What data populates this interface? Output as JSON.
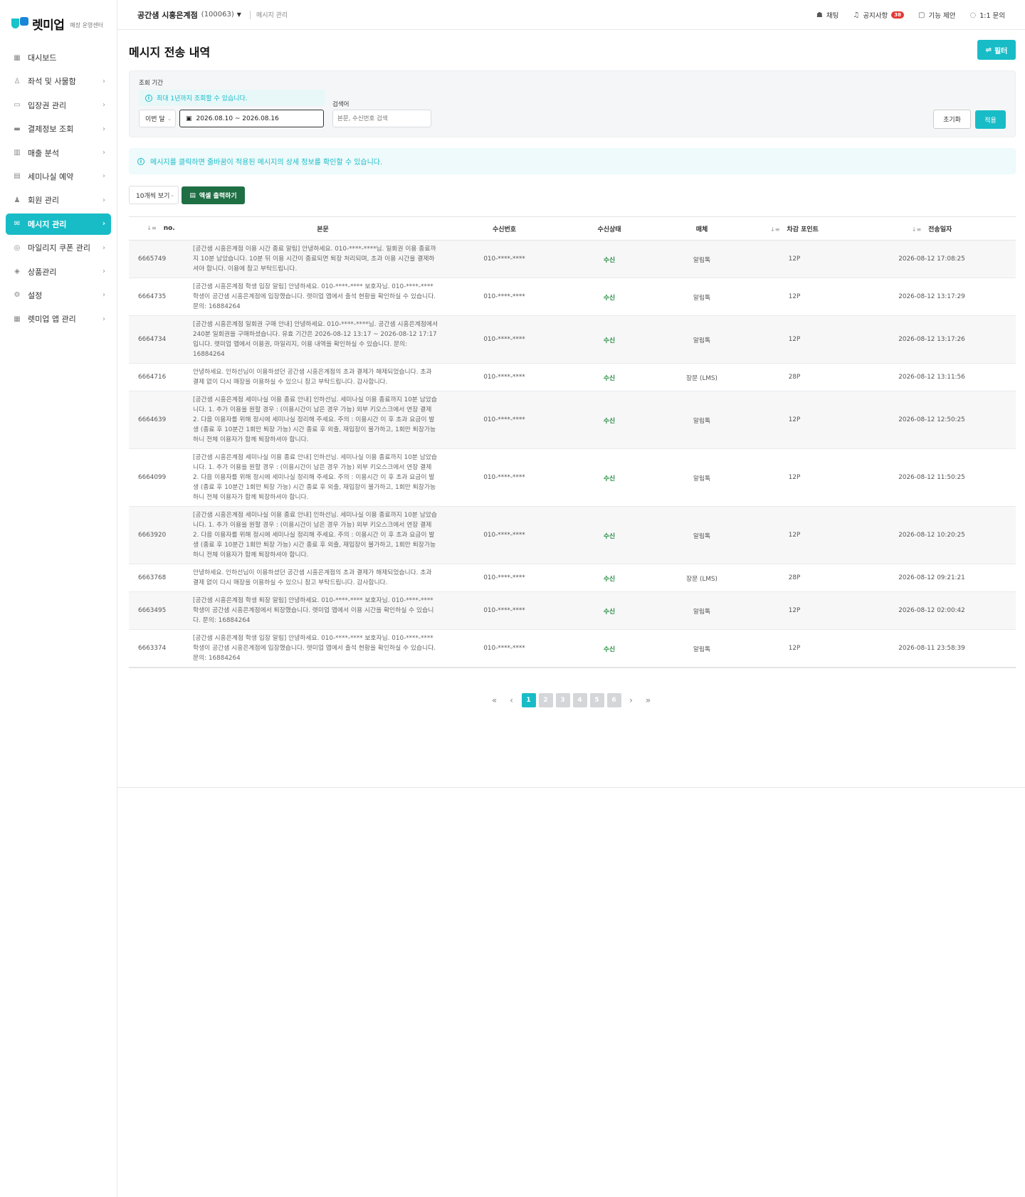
{
  "brand": {
    "name": "렛미업",
    "sub": "매장 운영센터"
  },
  "sidebar": {
    "items": [
      {
        "label": "대시보드",
        "icon": "▦",
        "chevron": false,
        "active": false
      },
      {
        "label": "좌석 및 사물함",
        "icon": "♙",
        "chevron": true,
        "active": false
      },
      {
        "label": "입장권 관리",
        "icon": "▭",
        "chevron": true,
        "active": false
      },
      {
        "label": "결제정보 조회",
        "icon": "▬",
        "chevron": true,
        "active": false
      },
      {
        "label": "매출 분석",
        "icon": "▥",
        "chevron": true,
        "active": false
      },
      {
        "label": "세미나실 예약",
        "icon": "▤",
        "chevron": true,
        "active": false
      },
      {
        "label": "회원 관리",
        "icon": "♟",
        "chevron": true,
        "active": false
      },
      {
        "label": "메시지 관리",
        "icon": "✉",
        "chevron": true,
        "active": true
      },
      {
        "label": "마일리지 쿠폰 관리",
        "icon": "◎",
        "chevron": true,
        "active": false
      },
      {
        "label": "상품관리",
        "icon": "◈",
        "chevron": true,
        "active": false
      },
      {
        "label": "설정",
        "icon": "⚙",
        "chevron": true,
        "active": false
      },
      {
        "label": "렛미업 앱 관리",
        "icon": "▦",
        "chevron": true,
        "active": false
      }
    ]
  },
  "header": {
    "store_name": "공간샘 시흥은계점",
    "store_id": "(100063)",
    "breadcrumb": "메시지 관리",
    "actions": [
      {
        "label": "채팅",
        "icon": "☗",
        "badge": ""
      },
      {
        "label": "공지사항",
        "icon": "♫",
        "badge": "38"
      },
      {
        "label": "기능 제안",
        "icon": "▢",
        "badge": ""
      },
      {
        "label": "1:1 문의",
        "icon": "◌",
        "badge": ""
      }
    ]
  },
  "page": {
    "title": "메시지 전송 내역",
    "filter_button": "필터"
  },
  "filter": {
    "period_label": "조회 기간",
    "period_note": "최대 1년까지 조회할 수 있습니다.",
    "period_select": "이번 달",
    "date_range": "2026.08.10 ~ 2026.08.16",
    "keyword_label": "검색어",
    "keyword_placeholder": "본문, 수신번호 검색",
    "reset": "초기화",
    "apply": "적용"
  },
  "banner": "메시지를 클릭하면 줄바꿈이 적용된 메시지의 상세 정보를 확인할 수 있습니다.",
  "toolbar": {
    "page_size": "10개씩 보기",
    "excel": "엑셀 출력하기"
  },
  "table": {
    "headers": [
      "no.",
      "본문",
      "수신번호",
      "수신상태",
      "매체",
      "차감 포인트",
      "전송일자"
    ],
    "rows": [
      {
        "no": "6665749",
        "body": "[공간샘 시흥은계점 이용 시간 종료 알림] 안녕하세요. 010-****-****님. 일회권 이용 종료까지 10분 남았습니다. 10분 뒤 이용 시간이 종료되면 퇴장 처리되며, 초과 이용 시간을 결제하셔야 합니다. 이용에 참고 부탁드립니다.",
        "phone": "010-****-****",
        "status": "수신",
        "media": "알림톡",
        "point": "12P",
        "date": "2026-08-12 17:08:25"
      },
      {
        "no": "6664735",
        "body": "[공간샘 시흥은계점 학생 입장 알림] 안녕하세요. 010-****-**** 보호자님. 010-****-**** 학생이 공간샘 시흥은계점에 입장했습니다. 렛미업 앱에서 출석 현황을 확인하실 수 있습니다. 문의: 16884264",
        "phone": "010-****-****",
        "status": "수신",
        "media": "알림톡",
        "point": "12P",
        "date": "2026-08-12 13:17:29"
      },
      {
        "no": "6664734",
        "body": "[공간샘 시흥은계점 일회권 구매 안내] 안녕하세요. 010-****-****님. 공간샘 시흥은계점에서 240분 일회권을 구매하셨습니다. 유효 기간은 2026-08-12 13:17 ~ 2026-08-12 17:17 입니다. 렛미업 앱에서 이용권, 마일리지, 이용 내역을 확인하실 수 있습니다. 문의: 16884264",
        "phone": "010-****-****",
        "status": "수신",
        "media": "알림톡",
        "point": "12P",
        "date": "2026-08-12 13:17:26"
      },
      {
        "no": "6664716",
        "body": "안녕하세요. 인하선님이 이용하셨던 공간샘 시흥은계점의 초과 결제가 해제되었습니다. 초과 결제 없이 다시 매장을 이용하실 수 있으니 참고 부탁드립니다. 감사합니다.",
        "phone": "010-****-****",
        "status": "수신",
        "media": "장문 (LMS)",
        "point": "28P",
        "date": "2026-08-12 13:11:56"
      },
      {
        "no": "6664639",
        "body": "[공간샘 시흥은계점 세미나실 이용 종료 안내] 인하선님. 세미나실 이용 종료까지 10분 남았습니다. 1. 추가 이용을 원할 경우 : (이용시간이 남은 경우 가능) 외부 키오스크에서 연장 결제 2. 다음 이용자를 위해 정시에 세미나실 정리해 주세요. 주의 : 이용시간 이 후 초과 요금이 발생 (종료 후 10분간 1회만 퇴장 가능) 시간 종료 후 외출, 재입장이 불가하고, 1회만 퇴장가능하니 전체 이용자가 함께 퇴장하셔야 합니다.",
        "phone": "010-****-****",
        "status": "수신",
        "media": "알림톡",
        "point": "12P",
        "date": "2026-08-12 12:50:25"
      },
      {
        "no": "6664099",
        "body": "[공간샘 시흥은계점 세미나실 이용 종료 안내] 인하선님. 세미나실 이용 종료까지 10분 남았습니다. 1. 추가 이용을 원할 경우 : (이용시간이 남은 경우 가능) 외부 키오스크에서 연장 결제 2. 다음 이용자를 위해 정시에 세미나실 정리해 주세요. 주의 : 이용시간 이 후 초과 요금이 발생 (종료 후 10분간 1회만 퇴장 가능) 시간 종료 후 외출, 재입장이 불가하고, 1회만 퇴장가능하니 전체 이용자가 함께 퇴장하셔야 합니다.",
        "phone": "010-****-****",
        "status": "수신",
        "media": "알림톡",
        "point": "12P",
        "date": "2026-08-12 11:50:25"
      },
      {
        "no": "6663920",
        "body": "[공간샘 시흥은계점 세미나실 이용 종료 안내] 인하선님. 세미나실 이용 종료까지 10분 남았습니다. 1. 추가 이용을 원할 경우 : (이용시간이 남은 경우 가능) 외부 키오스크에서 연장 결제 2. 다음 이용자를 위해 정시에 세미나실 정리해 주세요. 주의 : 이용시간 이 후 초과 요금이 발생 (종료 후 10분간 1회만 퇴장 가능) 시간 종료 후 외출, 재입장이 불가하고, 1회만 퇴장가능하니 전체 이용자가 함께 퇴장하셔야 합니다.",
        "phone": "010-****-****",
        "status": "수신",
        "media": "알림톡",
        "point": "12P",
        "date": "2026-08-12 10:20:25"
      },
      {
        "no": "6663768",
        "body": "안녕하세요. 인하선님이 이용하셨던 공간샘 시흥은계점의 초과 결제가 해제되었습니다. 초과 결제 없이 다시 매장을 이용하실 수 있으니 참고 부탁드립니다. 감사합니다.",
        "phone": "010-****-****",
        "status": "수신",
        "media": "장문 (LMS)",
        "point": "28P",
        "date": "2026-08-12 09:21:21"
      },
      {
        "no": "6663495",
        "body": "[공간샘 시흥은계점 학생 퇴장 알림] 안녕하세요. 010-****-**** 보호자님. 010-****-**** 학생이 공간샘 시흥은계점에서 퇴장했습니다. 렛미업 앱에서 이용 시간을 확인하실 수 있습니다. 문의: 16884264",
        "phone": "010-****-****",
        "status": "수신",
        "media": "알림톡",
        "point": "12P",
        "date": "2026-08-12 02:00:42"
      },
      {
        "no": "6663374",
        "body": "[공간샘 시흥은계점 학생 입장 알림] 안녕하세요. 010-****-**** 보호자님. 010-****-**** 학생이 공간샘 시흥은계점에 입장했습니다. 렛미업 앱에서 출석 현황을 확인하실 수 있습니다. 문의: 16884264",
        "phone": "010-****-****",
        "status": "수신",
        "media": "알림톡",
        "point": "12P",
        "date": "2026-08-11 23:58:39"
      }
    ]
  },
  "pagination": {
    "pages": [
      "1",
      "2",
      "3",
      "4",
      "5",
      "6"
    ],
    "current": "1"
  },
  "colors": {
    "accent": "#18bcc7",
    "excel": "#1f6f45",
    "status_ok": "#1e8a3c",
    "badge": "#e53935"
  }
}
